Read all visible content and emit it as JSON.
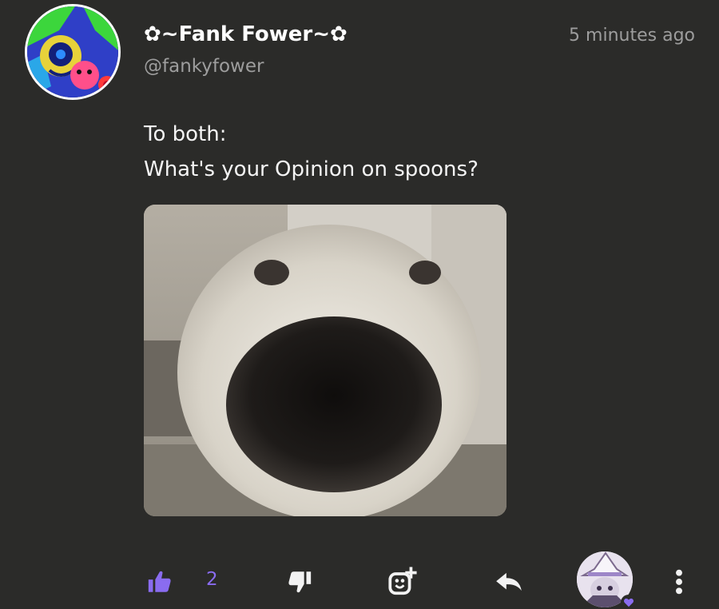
{
  "author": {
    "display_name": "✿~Fank Fower~✿",
    "handle": "@fankyfower",
    "avatar_icon": "cartoon-character-avatar"
  },
  "post": {
    "timestamp": "5 minutes ago",
    "lines": [
      "To both:",
      "What's your Opinion on spoons?"
    ],
    "media_description_icon": "dog-nose-closeup-image"
  },
  "actions": {
    "like_icon": "thumbs-up-icon",
    "like_count": "2",
    "dislike_icon": "thumbs-down-icon",
    "react_icon": "add-emoji-icon",
    "reply_icon": "reply-arrow-icon",
    "more_icon": "vertical-dots-icon"
  },
  "colors": {
    "background": "#2b2b29",
    "accent": "#8a6cf0",
    "muted_text": "#9d9d9d",
    "text": "#f4f4f4"
  }
}
